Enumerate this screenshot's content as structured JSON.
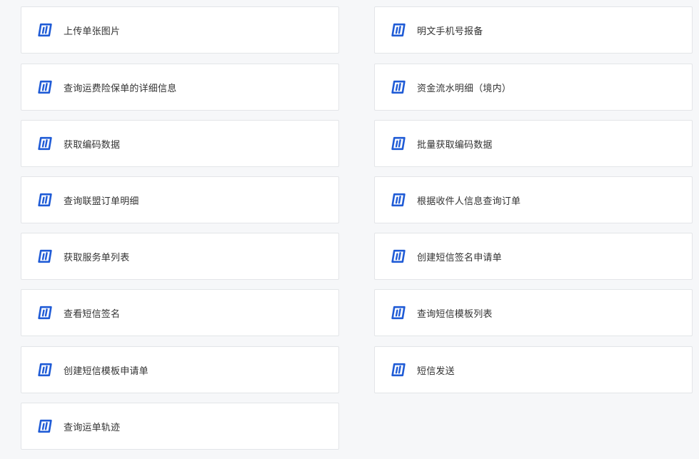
{
  "theme": {
    "background": "#f6f7f9",
    "card_border": "#e3e5e8",
    "icon_color": "#1f5bd6",
    "text_color": "#333333"
  },
  "api_list": {
    "items": [
      {
        "label": "上传单张图片",
        "icon": "api-logo-icon"
      },
      {
        "label": "明文手机号报备",
        "icon": "api-logo-icon"
      },
      {
        "label": "查询运费险保单的详细信息",
        "icon": "api-logo-icon"
      },
      {
        "label": "资金流水明细（境内）",
        "icon": "api-logo-icon"
      },
      {
        "label": "获取编码数据",
        "icon": "api-logo-icon"
      },
      {
        "label": "批量获取编码数据",
        "icon": "api-logo-icon"
      },
      {
        "label": "查询联盟订单明细",
        "icon": "api-logo-icon"
      },
      {
        "label": "根据收件人信息查询订单",
        "icon": "api-logo-icon"
      },
      {
        "label": "获取服务单列表",
        "icon": "api-logo-icon"
      },
      {
        "label": "创建短信签名申请单",
        "icon": "api-logo-icon"
      },
      {
        "label": "查看短信签名",
        "icon": "api-logo-icon"
      },
      {
        "label": "查询短信模板列表",
        "icon": "api-logo-icon"
      },
      {
        "label": "创建短信模板申请单",
        "icon": "api-logo-icon"
      },
      {
        "label": "短信发送",
        "icon": "api-logo-icon"
      },
      {
        "label": "查询运单轨迹",
        "icon": "api-logo-icon"
      }
    ]
  }
}
